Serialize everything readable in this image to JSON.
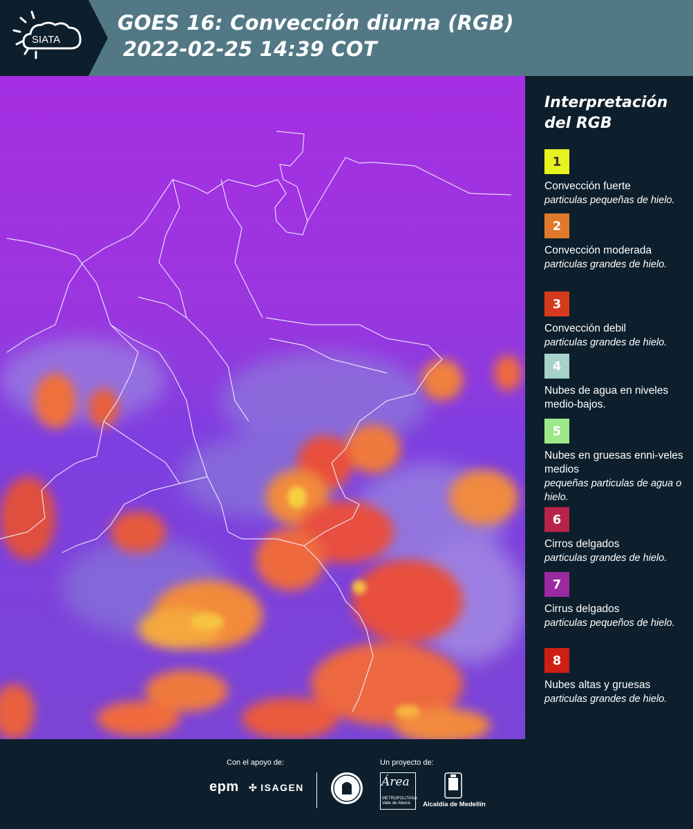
{
  "header": {
    "logo_text": "SIATA",
    "title_line1": "GOES 16: Convección diurna (RGB)",
    "title_line2": "2022-02-25 14:39 COT",
    "background_color": "#527885"
  },
  "map": {
    "image_type": "satellite RGB composite over Colombia",
    "dominant_colors": [
      "#9a2fe0",
      "#7a3ee0",
      "#f08a3c",
      "#f25a3a",
      "#f0d040"
    ]
  },
  "legend": {
    "title": "Interpretación del RGB",
    "items": [
      {
        "number": "1",
        "color": "#e8f21e",
        "text_color": "#333333",
        "desc": "Convección fuerte",
        "sub": "particulas pequeñas de hielo."
      },
      {
        "number": "2",
        "color": "#e07a2a",
        "text_color": "#ffffff",
        "desc": "Convección moderada",
        "sub": "particulas grandes de hielo."
      },
      {
        "number": "3",
        "color": "#d63a1c",
        "text_color": "#ffffff",
        "desc": "Convección debil",
        "sub": "particulas grandes de hielo."
      },
      {
        "number": "4",
        "color": "#a6d2ca",
        "text_color": "#ffffff",
        "desc": "Nubes de agua en niveles medio-bajos.",
        "sub": ""
      },
      {
        "number": "5",
        "color": "#9ee88a",
        "text_color": "#ffffff",
        "desc": "Nubes en gruesas enni-veles medios",
        "sub": "pequeñas particulas de agua o hielo."
      },
      {
        "number": "6",
        "color": "#b8234a",
        "text_color": "#ffffff",
        "desc": "Cirros delgados",
        "sub": "particulas grandes de hielo."
      },
      {
        "number": "7",
        "color": "#9b2aa0",
        "text_color": "#ffffff",
        "desc": "Cirrus delgados",
        "sub": "particulas pequeños de hielo."
      },
      {
        "number": "8",
        "color": "#cf1f15",
        "text_color": "#ffffff",
        "desc": "Nubes altas y gruesas",
        "sub": "particulas grandes de hielo."
      }
    ]
  },
  "footer": {
    "support_label": "Con el apoyo de:",
    "project_label": "Un proyecto de:",
    "epm": "epm",
    "isagen": "ISAGEN",
    "area_name": "Área",
    "area_sub_1": "METROPOLITANA",
    "area_sub_2": "Valle de Aburrá",
    "alcaldia": "Alcaldía de Medellín"
  }
}
